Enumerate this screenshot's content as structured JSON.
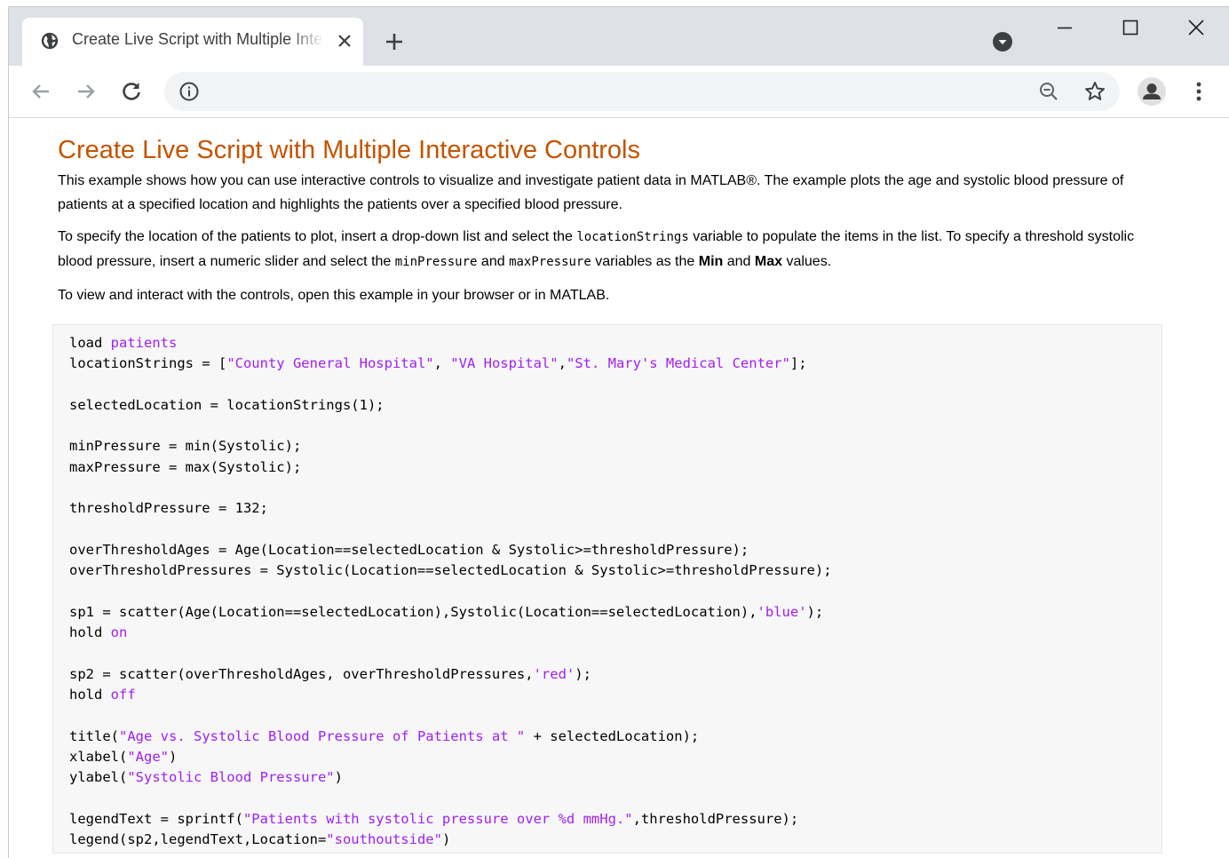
{
  "browser": {
    "tab_title": "Create Live Script with Multiple Interactive Controls",
    "window_controls": [
      "minimize-icon",
      "maximize-icon",
      "close-icon"
    ],
    "toolbar_icons": [
      "back-arrow-icon",
      "forward-arrow-icon",
      "reload-icon",
      "info-icon",
      "zoom-icon",
      "star-icon",
      "profile-icon",
      "menu-icon"
    ]
  },
  "page": {
    "title": "Create Live Script with Multiple Interactive Controls",
    "para1": "This example shows how you can use interactive controls to visualize and investigate patient data in MATLAB®. The example plots the age and systolic blood pressure of patients at a specified location and highlights the patients over a specified blood pressure.",
    "para2": {
      "t1": "To specify the location of the patients to plot, insert a drop-down list and select the ",
      "c1": "locationStrings",
      "t2": " variable to populate the items in the list. To specify a threshold systolic blood pressure, insert a numeric slider and select the ",
      "c2": "minPressure",
      "t3": " and ",
      "c3": "maxPressure",
      "t4": " variables as the ",
      "b1": "Min",
      "t5": " and ",
      "b2": "Max",
      "t6": " values."
    },
    "para3": "To view and interact with the controls, open this example in your browser or in MATLAB."
  },
  "code": {
    "line01": [
      {
        "t": "load "
      },
      {
        "k": "patients"
      }
    ],
    "line02": [
      {
        "t": "locationStrings = ["
      },
      {
        "s": "\"County General Hospital\""
      },
      {
        "t": ", "
      },
      {
        "s": "\"VA Hospital\""
      },
      {
        "t": ","
      },
      {
        "s": "\"St. Mary's Medical Center\""
      },
      {
        "t": "];"
      }
    ],
    "line03": [],
    "line04": [
      {
        "t": "selectedLocation = locationStrings(1);"
      }
    ],
    "line05": [],
    "line06": [
      {
        "t": "minPressure = min(Systolic);"
      }
    ],
    "line07": [
      {
        "t": "maxPressure = max(Systolic);"
      }
    ],
    "line08": [],
    "line09": [
      {
        "t": "thresholdPressure = 132;"
      }
    ],
    "line10": [],
    "line11": [
      {
        "t": "overThresholdAges = Age(Location==selectedLocation & Systolic>=thresholdPressure);"
      }
    ],
    "line12": [
      {
        "t": "overThresholdPressures = Systolic(Location==selectedLocation & Systolic>=thresholdPressure);"
      }
    ],
    "line13": [],
    "line14": [
      {
        "t": "sp1 = scatter(Age(Location==selectedLocation),Systolic(Location==selectedLocation),"
      },
      {
        "s": "'blue'"
      },
      {
        "t": ");"
      }
    ],
    "line15": [
      {
        "t": "hold "
      },
      {
        "k": "on"
      }
    ],
    "line16": [],
    "line17": [
      {
        "t": "sp2 = scatter(overThresholdAges, overThresholdPressures,"
      },
      {
        "s": "'red'"
      },
      {
        "t": ");"
      }
    ],
    "line18": [
      {
        "t": "hold "
      },
      {
        "k": "off"
      }
    ],
    "line19": [],
    "line20": [
      {
        "t": "title("
      },
      {
        "s": "\"Age vs. Systolic Blood Pressure of Patients at \""
      },
      {
        "t": " + selectedLocation);"
      }
    ],
    "line21": [
      {
        "t": "xlabel("
      },
      {
        "s": "\"Age\""
      },
      {
        "t": ")"
      }
    ],
    "line22": [
      {
        "t": "ylabel("
      },
      {
        "s": "\"Systolic Blood Pressure\""
      },
      {
        "t": ")"
      }
    ],
    "line23": [],
    "line24": [
      {
        "t": "legendText = sprintf("
      },
      {
        "s": "\"Patients with systolic pressure over %d mmHg.\""
      },
      {
        "t": ",thresholdPressure);"
      }
    ],
    "line25": [
      {
        "t": "legend(sp2,legendText,Location="
      },
      {
        "s": "\"southoutside\""
      },
      {
        "t": ")"
      }
    ]
  },
  "colors": {
    "title": "#c45400",
    "code_keyword": "#a020f0",
    "code_string": "#a020f0",
    "code_background": "#f7f7f7",
    "tabstrip": "#dee1e6"
  }
}
